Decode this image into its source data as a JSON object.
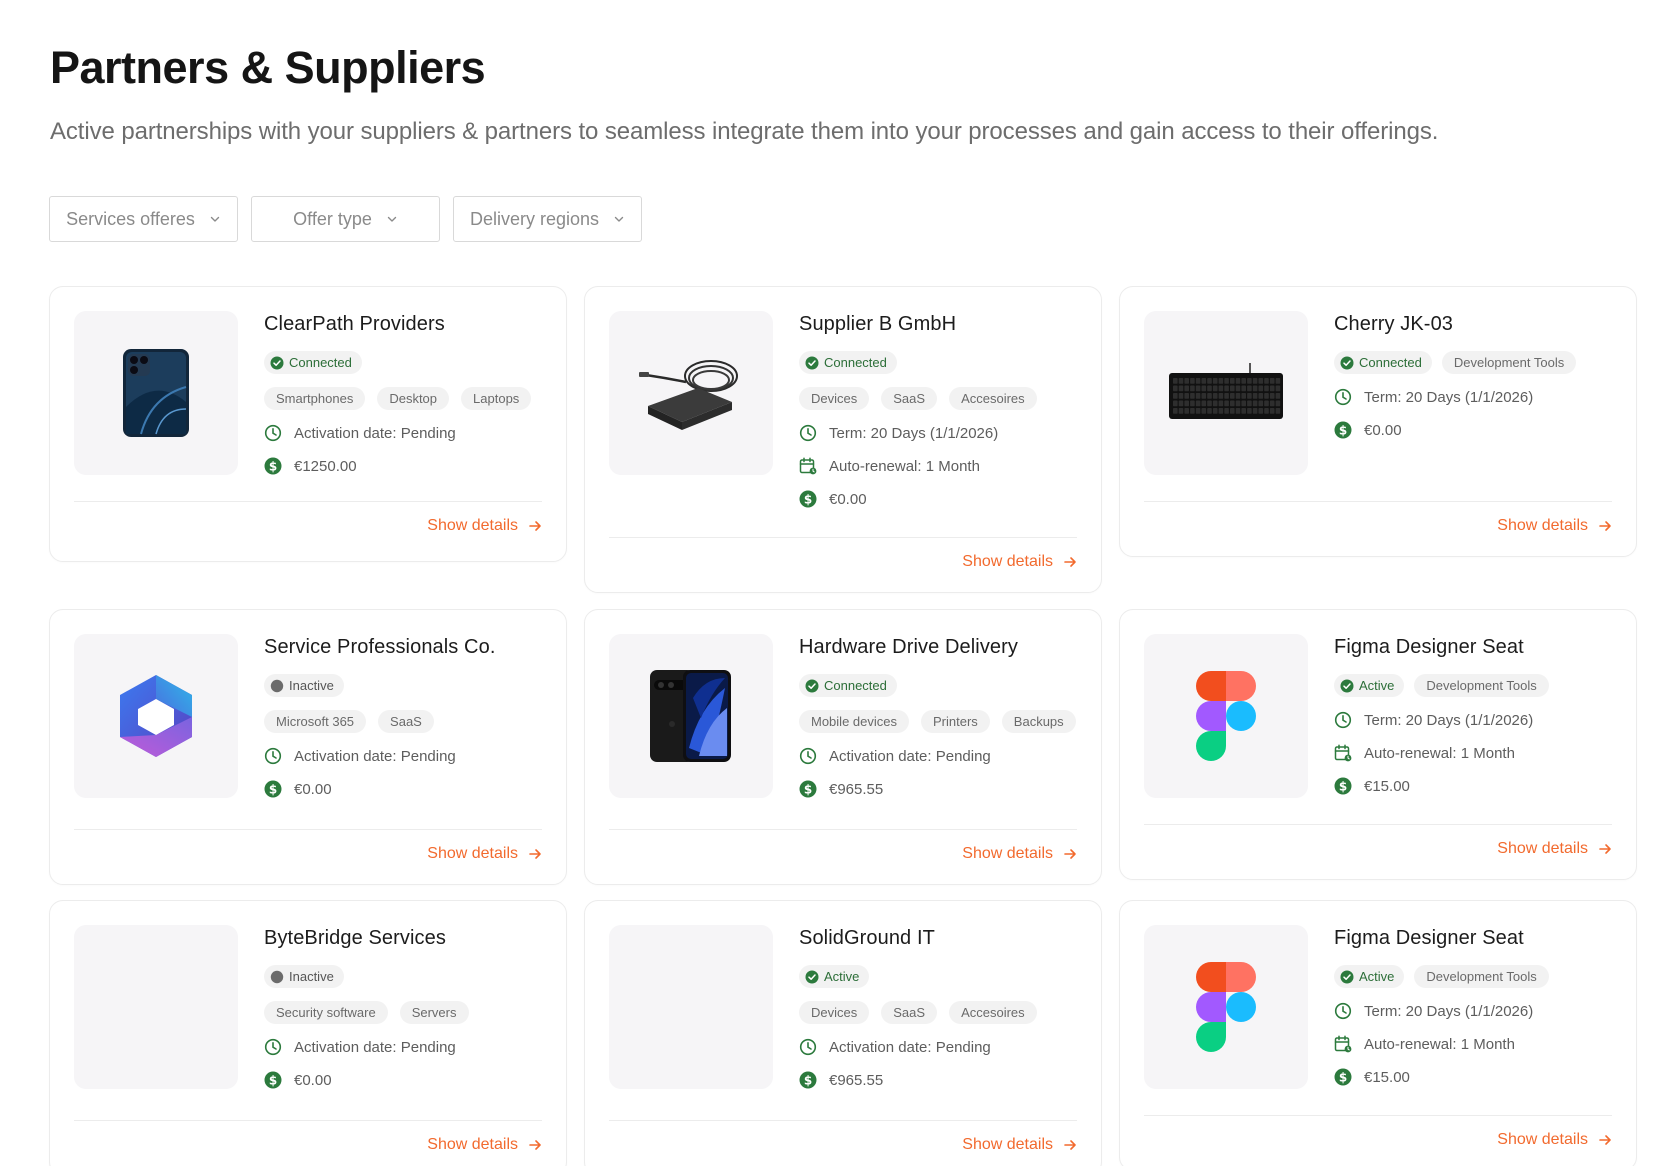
{
  "header": {
    "title": "Partners & Suppliers",
    "subtitle": "Active partnerships with your suppliers & partners to seamless integrate them into your processes and gain access to their offerings."
  },
  "filters": [
    {
      "label": "Services offeres"
    },
    {
      "label": "Offer type"
    },
    {
      "label": "Delivery regions"
    }
  ],
  "colors": {
    "accent": "#f26a2e",
    "connected_green": "#2c7a3d",
    "inactive_gray": "#6b6b6b"
  },
  "cards": [
    {
      "name": "ClearPath Providers",
      "image": "smartphone-blue-icon",
      "status": "Connected",
      "status_kind": "ok",
      "extra_badge": "",
      "tags": [
        "Smartphones",
        "Desktop",
        "Laptops"
      ],
      "meta": [
        {
          "icon": "clock-icon",
          "text": "Activation date: Pending"
        },
        {
          "icon": "dollar-icon",
          "text": "€1250.00"
        }
      ],
      "action": "Show details"
    },
    {
      "name": "Supplier B GmbH",
      "image": "usb-hub-icon",
      "status": "Connected",
      "status_kind": "ok",
      "extra_badge": "",
      "tags": [
        "Devices",
        "SaaS",
        "Accesoires"
      ],
      "meta": [
        {
          "icon": "clock-icon",
          "text": "Term: 20 Days (1/1/2026)"
        },
        {
          "icon": "calendar-icon",
          "text": "Auto-renewal: 1 Month"
        },
        {
          "icon": "dollar-icon",
          "text": "€0.00"
        }
      ],
      "action": "Show details"
    },
    {
      "name": "Cherry JK-03",
      "image": "keyboard-icon",
      "status": "Connected",
      "status_kind": "ok",
      "extra_badge": "Development Tools",
      "tags": [],
      "meta": [
        {
          "icon": "clock-icon",
          "text": "Term: 20 Days (1/1/2026)"
        },
        {
          "icon": "dollar-icon",
          "text": "€0.00"
        }
      ],
      "action": "Show details"
    },
    {
      "name": "Service Professionals Co.",
      "image": "microsoft365-logo-icon",
      "status": "Inactive",
      "status_kind": "off",
      "extra_badge": "",
      "tags": [
        "Microsoft 365",
        "SaaS"
      ],
      "meta": [
        {
          "icon": "clock-icon",
          "text": "Activation date: Pending"
        },
        {
          "icon": "dollar-icon",
          "text": "€0.00"
        }
      ],
      "action": "Show details"
    },
    {
      "name": "Hardware Drive Delivery",
      "image": "smartphone-black-icon",
      "status": "Connected",
      "status_kind": "ok",
      "extra_badge": "",
      "tags": [
        "Mobile devices",
        "Printers",
        "Backups"
      ],
      "meta": [
        {
          "icon": "clock-icon",
          "text": "Activation date: Pending"
        },
        {
          "icon": "dollar-icon",
          "text": "€965.55"
        }
      ],
      "action": "Show details"
    },
    {
      "name": "Figma Designer Seat",
      "image": "figma-logo-icon",
      "status": "Active",
      "status_kind": "ok",
      "extra_badge": "Development Tools",
      "tags": [],
      "meta": [
        {
          "icon": "clock-icon",
          "text": "Term: 20 Days (1/1/2026)"
        },
        {
          "icon": "calendar-icon",
          "text": "Auto-renewal: 1 Month"
        },
        {
          "icon": "dollar-icon",
          "text": "€15.00"
        }
      ],
      "action": "Show details"
    },
    {
      "name": "ByteBridge Services",
      "image": "",
      "status": "Inactive",
      "status_kind": "off",
      "extra_badge": "",
      "tags": [
        "Security software",
        "Servers"
      ],
      "meta": [
        {
          "icon": "clock-icon",
          "text": "Activation date: Pending"
        },
        {
          "icon": "dollar-icon",
          "text": "€0.00"
        }
      ],
      "action": "Show details"
    },
    {
      "name": "SolidGround IT",
      "image": "",
      "status": "Active",
      "status_kind": "ok",
      "extra_badge": "",
      "tags": [
        "Devices",
        "SaaS",
        "Accesoires"
      ],
      "meta": [
        {
          "icon": "clock-icon",
          "text": "Activation date: Pending"
        },
        {
          "icon": "dollar-icon",
          "text": "€965.55"
        }
      ],
      "action": "Show details"
    },
    {
      "name": "Figma Designer Seat",
      "image": "figma-logo-icon",
      "status": "Active",
      "status_kind": "ok",
      "extra_badge": "Development Tools",
      "tags": [],
      "meta": [
        {
          "icon": "clock-icon",
          "text": "Term: 20 Days (1/1/2026)"
        },
        {
          "icon": "calendar-icon",
          "text": "Auto-renewal: 1 Month"
        },
        {
          "icon": "dollar-icon",
          "text": "€15.00"
        }
      ],
      "action": "Show details"
    }
  ]
}
